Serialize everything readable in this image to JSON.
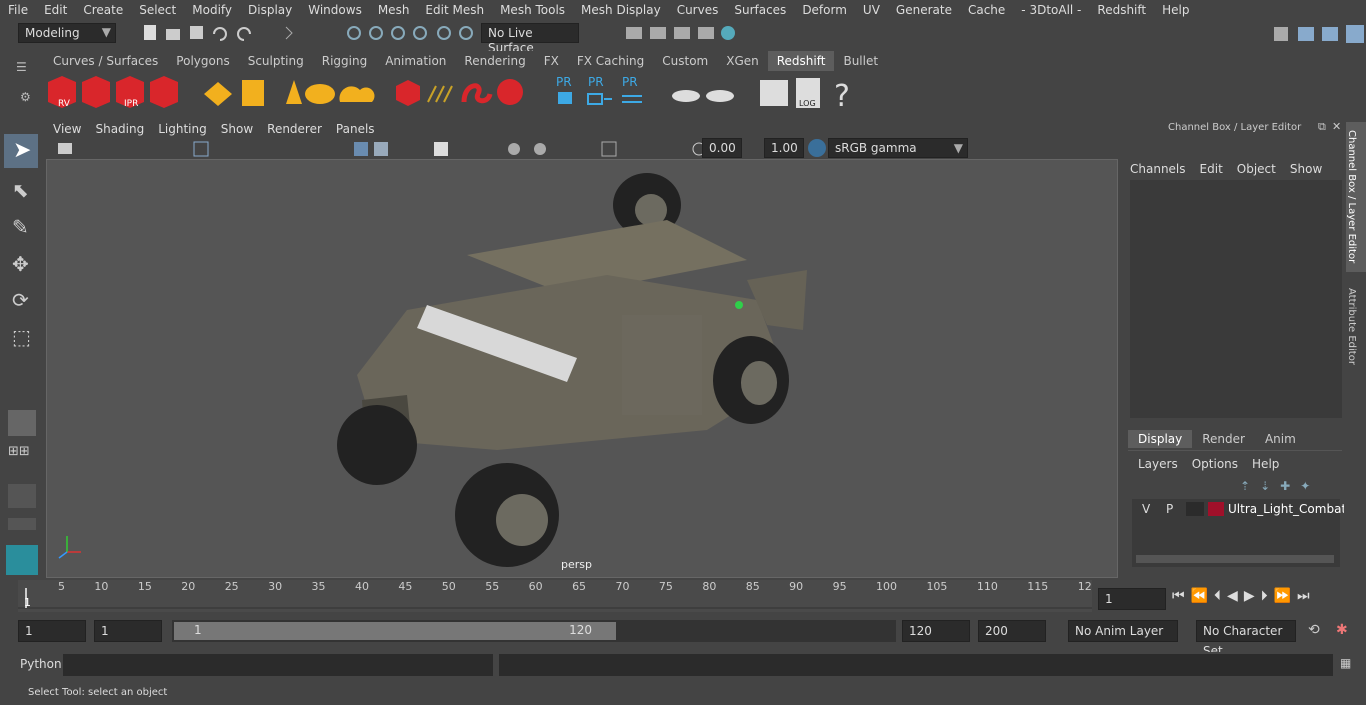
{
  "menubar": [
    "File",
    "Edit",
    "Create",
    "Select",
    "Modify",
    "Display",
    "Windows",
    "Mesh",
    "Edit Mesh",
    "Mesh Tools",
    "Mesh Display",
    "Curves",
    "Surfaces",
    "Deform",
    "UV",
    "Generate",
    "Cache",
    "- 3DtoAll -",
    "Redshift",
    "Help"
  ],
  "status": {
    "mode": "Modeling",
    "live_surface": "No Live Surface"
  },
  "shelf_tabs": [
    "Curves / Surfaces",
    "Polygons",
    "Sculpting",
    "Rigging",
    "Animation",
    "Rendering",
    "FX",
    "FX Caching",
    "Custom",
    "XGen",
    "Redshift",
    "Bullet"
  ],
  "shelf_active": "Redshift",
  "shelf_labels": {
    "rv": "RV",
    "ipr": "IPR",
    "pr1": "PR",
    "pr2": "PR",
    "pr3": "PR",
    "log": "LOG"
  },
  "viewport_menu": [
    "View",
    "Shading",
    "Lighting",
    "Show",
    "Renderer",
    "Panels"
  ],
  "viewport": {
    "exposure": "0.00",
    "gamma": "1.00",
    "colorspace": "sRGB gamma",
    "camera_label": "persp"
  },
  "channel_box": {
    "title": "Channel Box / Layer Editor",
    "menu": [
      "Channels",
      "Edit",
      "Object",
      "Show"
    ]
  },
  "layer_editor": {
    "tabs": [
      "Display",
      "Render",
      "Anim"
    ],
    "active_tab": "Display",
    "menu": [
      "Layers",
      "Options",
      "Help"
    ],
    "layer": {
      "v": "V",
      "p": "P",
      "name": "Ultra_Light_Combat_V",
      "color": "#a0102a"
    }
  },
  "side_tabs": [
    "Channel Box / Layer Editor",
    "Attribute Editor"
  ],
  "timeline": {
    "ticks": [
      "5",
      "10",
      "15",
      "20",
      "25",
      "30",
      "35",
      "40",
      "45",
      "50",
      "55",
      "60",
      "65",
      "70",
      "75",
      "80",
      "85",
      "90",
      "95",
      "100",
      "105",
      "110",
      "115",
      "12"
    ],
    "current_frame": "1",
    "frame_field": "1"
  },
  "range": {
    "start": "1",
    "start2": "1",
    "slider_start": "1",
    "slider_end": "120",
    "end": "120",
    "end2": "200",
    "anim_layer": "No Anim Layer",
    "char_set": "No Character Set"
  },
  "cmd": {
    "label": "Python"
  },
  "help": {
    "text": "Select Tool: select an object"
  }
}
